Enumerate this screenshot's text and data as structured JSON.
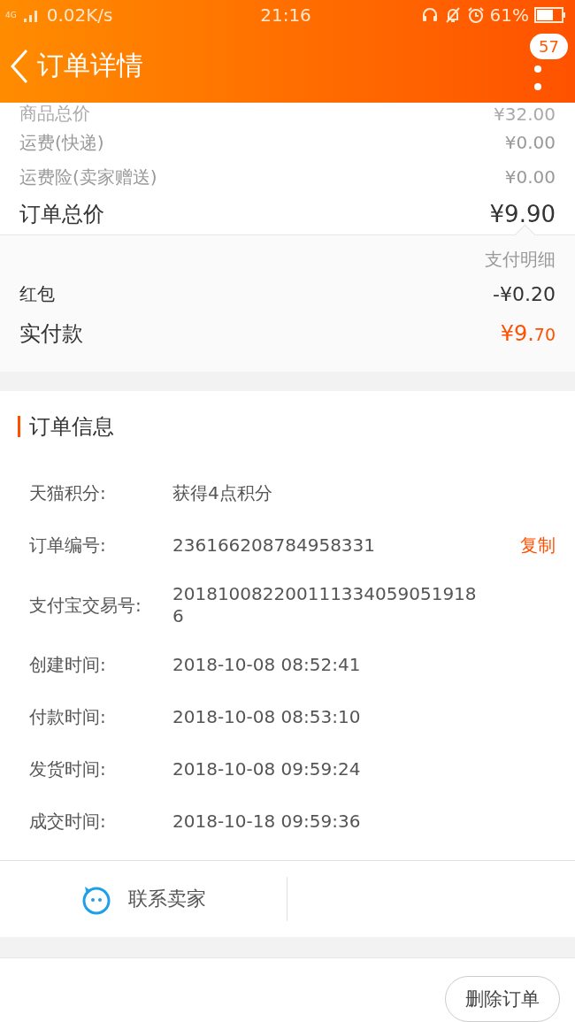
{
  "status_bar": {
    "network": "4G",
    "speed": "0.02K/s",
    "time": "21:16",
    "battery": "61%"
  },
  "header": {
    "title": "订单详情",
    "badge": "57"
  },
  "price_rows": [
    {
      "label": "商品总价",
      "value": "¥32.00",
      "kind": "cut"
    },
    {
      "label": "运费(快递)",
      "value": "¥0.00",
      "kind": "minor"
    },
    {
      "label": "运费险(卖家赠送)",
      "value": "¥0.00",
      "kind": "minor"
    },
    {
      "label": "订单总价",
      "value": "¥9.90",
      "kind": "total"
    }
  ],
  "payment": {
    "detail_link": "支付明细",
    "rows": [
      {
        "label": "红包",
        "value": "-¥0.20",
        "kind": "plain"
      },
      {
        "label": "实付款",
        "value": "¥9.",
        "value_small": "70",
        "kind": "paid"
      }
    ]
  },
  "order_info": {
    "title": "订单信息",
    "rows": [
      {
        "label": "天猫积分:",
        "value": "获得4点积分"
      },
      {
        "label": "订单编号:",
        "value": "236166208784958331",
        "action": "复制"
      },
      {
        "label": "支付宝交易号:",
        "value": "2018100822001113340590519186"
      },
      {
        "label": "创建时间:",
        "value": "2018-10-08 08:52:41"
      },
      {
        "label": "付款时间:",
        "value": "2018-10-08 08:53:10"
      },
      {
        "label": "发货时间:",
        "value": "2018-10-08 09:59:24"
      },
      {
        "label": "成交时间:",
        "value": "2018-10-18 09:59:36"
      }
    ]
  },
  "contact": {
    "label": "联系卖家"
  },
  "footer": {
    "button": "删除订单"
  }
}
